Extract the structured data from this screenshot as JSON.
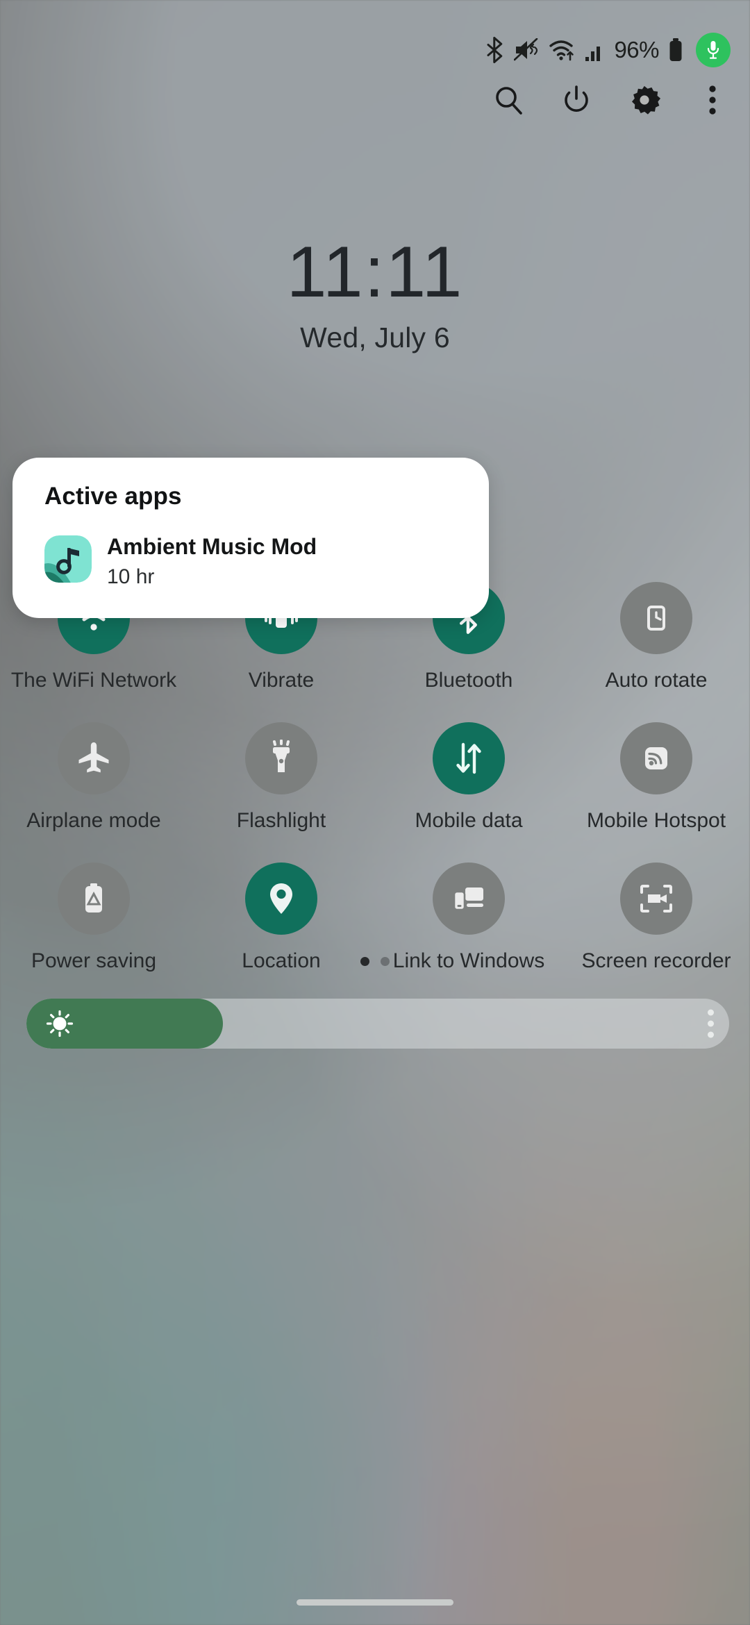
{
  "status_bar": {
    "battery_percent": "96%",
    "icons": [
      "bluetooth-icon",
      "mute-vibrate-off-icon",
      "wifi-icon",
      "cellular-signal-icon",
      "battery-icon"
    ],
    "mic_indicator": "microphone-active-icon",
    "mic_color": "#2ec25e"
  },
  "header": {
    "buttons": [
      {
        "name": "search-icon",
        "label": "Search"
      },
      {
        "name": "power-icon",
        "label": "Power off"
      },
      {
        "name": "gear-icon",
        "label": "Settings"
      },
      {
        "name": "overflow-menu-icon",
        "label": "More options"
      }
    ]
  },
  "lockscreen": {
    "time": "11:11",
    "date": "Wed, July 6"
  },
  "active_apps_card": {
    "title": "Active apps",
    "app_name": "Ambient Music Mod",
    "duration": "10 hr",
    "icon_name": "ambient-music-mod-icon",
    "icon_colors": {
      "base": "#7fe3d2",
      "wave_mid": "#3fae9a",
      "wave_dark": "#1d7a66",
      "note": "#1b2a33"
    }
  },
  "quick_settings": {
    "active_color": "#10705c",
    "inactive_color": "#7c7f7e",
    "rows": [
      [
        {
          "label": "The WiFi Network",
          "icon": "wifi-icon",
          "state": "on"
        },
        {
          "label": "Vibrate",
          "icon": "vibrate-icon",
          "state": "on"
        },
        {
          "label": "Bluetooth",
          "icon": "bluetooth-icon",
          "state": "on"
        },
        {
          "label": "Auto rotate",
          "icon": "auto-rotate-icon",
          "state": "off"
        }
      ],
      [
        {
          "label": "Airplane mode",
          "icon": "airplane-icon",
          "state": "off"
        },
        {
          "label": "Flashlight",
          "icon": "flashlight-icon",
          "state": "off"
        },
        {
          "label": "Mobile data",
          "icon": "mobile-data-icon",
          "state": "on"
        },
        {
          "label": "Mobile Hotspot",
          "icon": "hotspot-icon",
          "state": "off"
        }
      ],
      [
        {
          "label": "Power saving",
          "icon": "power-saving-icon",
          "state": "off"
        },
        {
          "label": "Location",
          "icon": "location-pin-icon",
          "state": "on"
        },
        {
          "label": "Link to Windows",
          "icon": "link-to-windows-icon",
          "state": "off"
        },
        {
          "label": "Screen recorder",
          "icon": "screen-recorder-icon",
          "state": "off"
        }
      ]
    ]
  },
  "pager": {
    "total": 2,
    "active_index": 0
  },
  "brightness": {
    "level_percent": 28,
    "icon": "brightness-sun-icon",
    "more_icon": "overflow-menu-icon"
  },
  "navigation": {
    "pill": "gesture-nav-pill"
  }
}
